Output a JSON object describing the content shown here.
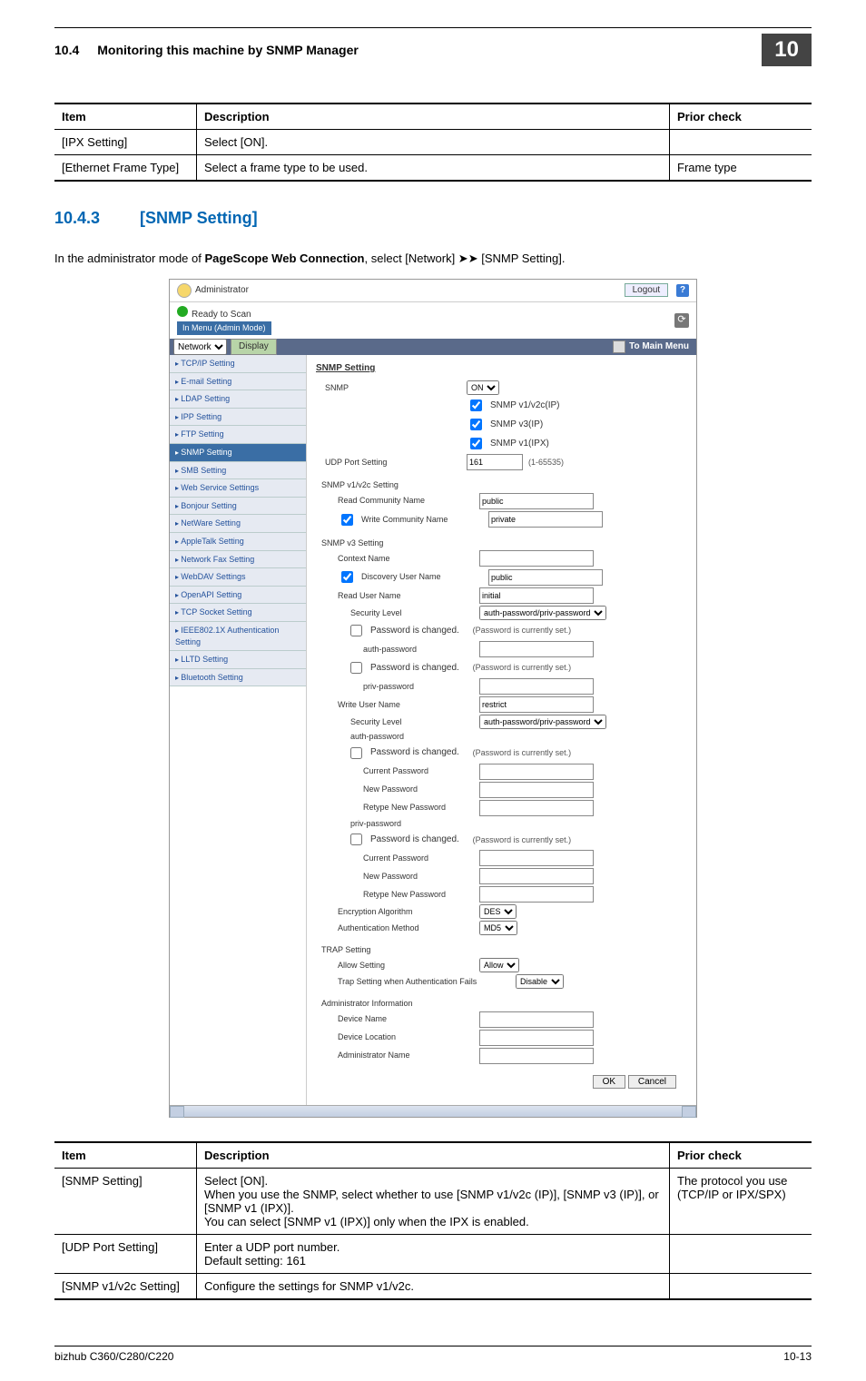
{
  "header": {
    "section_num": "10.4",
    "section_title": "Monitoring this machine by SNMP Manager",
    "badge": "10"
  },
  "table1": {
    "head": {
      "c1": "Item",
      "c2": "Description",
      "c3": "Prior check"
    },
    "rows": [
      {
        "c1": "[IPX Setting]",
        "c2": "Select [ON].",
        "c3": ""
      },
      {
        "c1": "[Ethernet Frame Type]",
        "c2": "Select a frame type to be used.",
        "c3": "Frame type"
      }
    ]
  },
  "section": {
    "num": "10.4.3",
    "title": "[SNMP Setting]",
    "intro_a": "In the administrator mode of ",
    "intro_b": "PageScope Web Connection",
    "intro_c": ", select [Network] ➤➤ [SNMP Setting]."
  },
  "mock": {
    "admin": "Administrator",
    "logout": "Logout",
    "ready": "Ready to Scan",
    "mode": "In Menu (Admin Mode)",
    "network": "Network",
    "display": "Display",
    "mainmenu": "To Main Menu",
    "side": [
      "TCP/IP Setting",
      "E-mail Setting",
      "LDAP Setting",
      "IPP Setting",
      "FTP Setting",
      "SNMP Setting",
      "SMB Setting",
      "Web Service Settings",
      "Bonjour Setting",
      "NetWare Setting",
      "AppleTalk Setting",
      "Network Fax Setting",
      "WebDAV Settings",
      "OpenAPI Setting",
      "TCP Socket Setting",
      "IEEE802.1X Authentication Setting",
      "LLTD Setting",
      "Bluetooth Setting"
    ],
    "h_snmp": "SNMP Setting",
    "l_snmp": "SNMP",
    "sel_on": "ON",
    "cb1": "SNMP v1/v2c(IP)",
    "cb2": "SNMP v3(IP)",
    "cb3": "SNMP v1(IPX)",
    "l_udp": "UDP Port Setting",
    "udp_val": "161",
    "udp_range": "(1-65535)",
    "h_v12": "SNMP v1/v2c Setting",
    "l_read": "Read Community Name",
    "v_read": "public",
    "l_write": "Write Community Name",
    "v_write": "private",
    "h_v3": "SNMP v3 Setting",
    "l_ctx": "Context Name",
    "l_disc": "Discovery User Name",
    "v_disc": "public",
    "l_ruser": "Read User Name",
    "v_ruser": "initial",
    "l_sec": "Security Level",
    "sel_sec": "auth-password/priv-password",
    "l_pwchg": "Password is changed.",
    "note_pw": "(Password is currently set.)",
    "l_auth": "auth-password",
    "l_priv": "priv-password",
    "l_wuser": "Write User Name",
    "v_wuser": "restrict",
    "l_cur": "Current Password",
    "l_new": "New Password",
    "l_ret": "Retype New Password",
    "l_encalg": "Encryption Algorithm",
    "sel_des": "DES",
    "l_authm": "Authentication Method",
    "sel_md5": "MD5",
    "h_trap": "TRAP Setting",
    "l_allow": "Allow Setting",
    "sel_allow": "Allow",
    "l_trapauth": "Trap Setting when Authentication Fails",
    "sel_disable": "Disable",
    "h_admin": "Administrator Information",
    "l_dev": "Device Name",
    "l_loc": "Device Location",
    "l_admn": "Administrator Name",
    "ok": "OK",
    "cancel": "Cancel"
  },
  "table2": {
    "head": {
      "c1": "Item",
      "c2": "Description",
      "c3": "Prior check"
    },
    "rows": [
      {
        "c1": "[SNMP Setting]",
        "c2": "Select [ON].\nWhen you use the SNMP, select whether to use [SNMP v1/v2c (IP)], [SNMP v3 (IP)], or [SNMP v1 (IPX)].\nYou can select [SNMP v1 (IPX)] only when the IPX is enabled.",
        "c3": "The protocol you use (TCP/IP or IPX/SPX)"
      },
      {
        "c1": "[UDP Port Setting]",
        "c2": "Enter a UDP port number.\nDefault setting: 161",
        "c3": ""
      },
      {
        "c1": "[SNMP v1/v2c Setting]",
        "c2": "Configure the settings for SNMP v1/v2c.",
        "c3": ""
      }
    ]
  },
  "footer": {
    "left": "bizhub C360/C280/C220",
    "right": "10-13"
  }
}
